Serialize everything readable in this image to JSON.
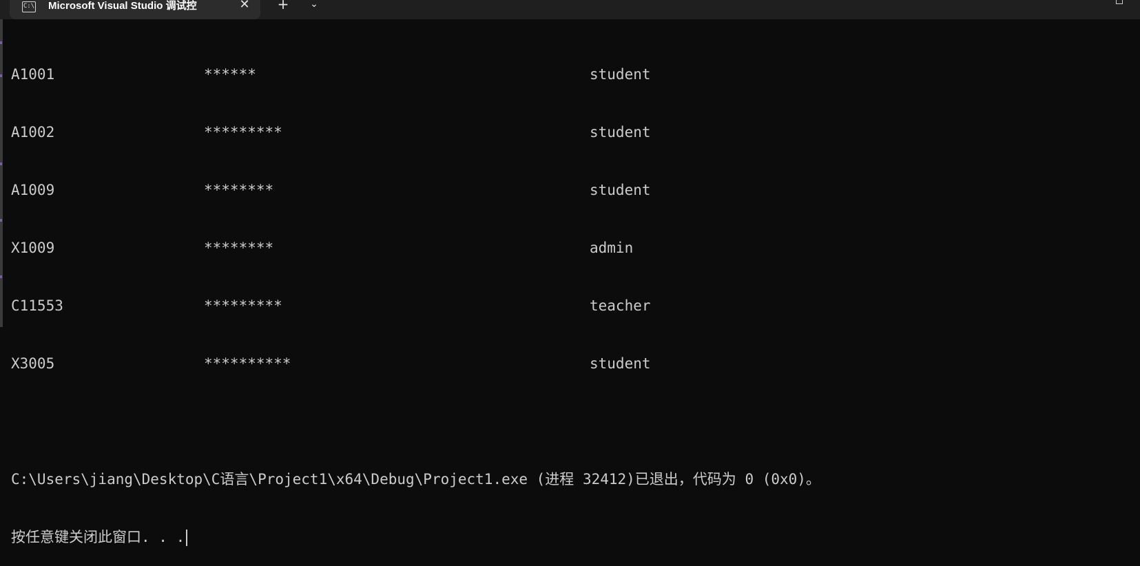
{
  "window": {
    "tab_title": "Microsoft Visual Studio 调试控",
    "tab_icon_text": "C:\\",
    "close_glyph": "✕",
    "new_tab_glyph": "+",
    "dropdown_glyph": "⌄"
  },
  "console": {
    "rows": [
      {
        "id": "A1001",
        "password": "******",
        "role": "student"
      },
      {
        "id": "A1002",
        "password": "*********",
        "role": "student"
      },
      {
        "id": "A1009",
        "password": "********",
        "role": "student"
      },
      {
        "id": "X1009",
        "password": "********",
        "role": "admin"
      },
      {
        "id": "C11553",
        "password": "*********",
        "role": "teacher"
      },
      {
        "id": "X3005",
        "password": "**********",
        "role": "student"
      }
    ],
    "exit_message": "C:\\Users\\jiang\\Desktop\\C语言\\Project1\\x64\\Debug\\Project1.exe (进程 32412)已退出，代码为 0 (0x0)。",
    "prompt": "按任意键关闭此窗口. . ."
  },
  "colors": {
    "background": "#0c0c0c",
    "text": "#cccccc",
    "titlebar": "#1f1f1f",
    "tab": "#2c2c2c"
  }
}
